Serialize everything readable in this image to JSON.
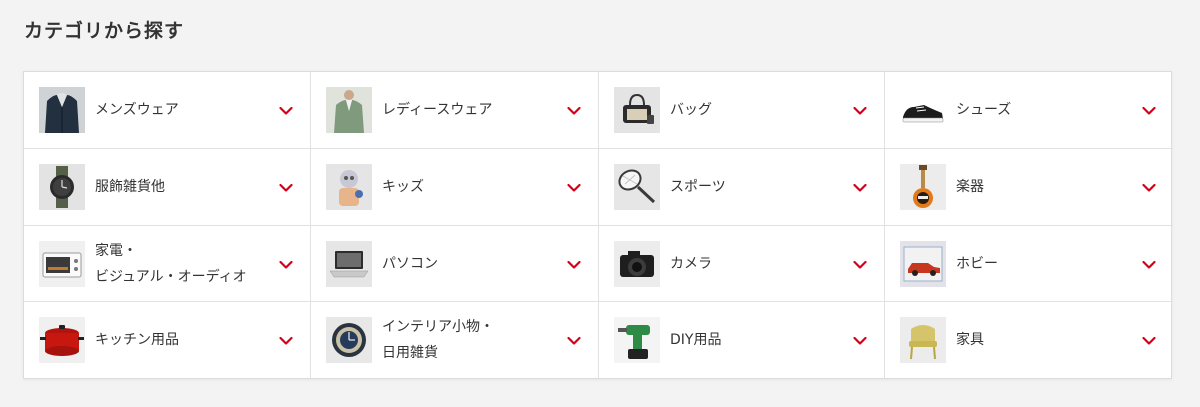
{
  "title": "カテゴリから探す",
  "accent_color": "#d0021b",
  "categories": [
    {
      "label": "メンズウェア",
      "label2": "",
      "icon": "mens-jacket-icon"
    },
    {
      "label": "レディースウェア",
      "label2": "",
      "icon": "ladies-cardigan-icon"
    },
    {
      "label": "バッグ",
      "label2": "",
      "icon": "bag-icon"
    },
    {
      "label": "シューズ",
      "label2": "",
      "icon": "sneaker-icon"
    },
    {
      "label": "服飾雑貨他",
      "label2": "",
      "icon": "watch-icon"
    },
    {
      "label": "キッズ",
      "label2": "",
      "icon": "kids-toy-icon"
    },
    {
      "label": "スポーツ",
      "label2": "",
      "icon": "tennis-racket-icon"
    },
    {
      "label": "楽器",
      "label2": "",
      "icon": "guitar-icon"
    },
    {
      "label": "家電・",
      "label2": "ビジュアル・オーディオ",
      "icon": "oven-toaster-icon"
    },
    {
      "label": "パソコン",
      "label2": "",
      "icon": "laptop-icon"
    },
    {
      "label": "カメラ",
      "label2": "",
      "icon": "camera-icon"
    },
    {
      "label": "ホビー",
      "label2": "",
      "icon": "toy-car-icon"
    },
    {
      "label": "キッチン用品",
      "label2": "",
      "icon": "pot-icon"
    },
    {
      "label": "インテリア小物・",
      "label2": "日用雑貨",
      "icon": "clock-icon"
    },
    {
      "label": "DIY用品",
      "label2": "",
      "icon": "drill-icon"
    },
    {
      "label": "家具",
      "label2": "",
      "icon": "chair-icon"
    }
  ]
}
